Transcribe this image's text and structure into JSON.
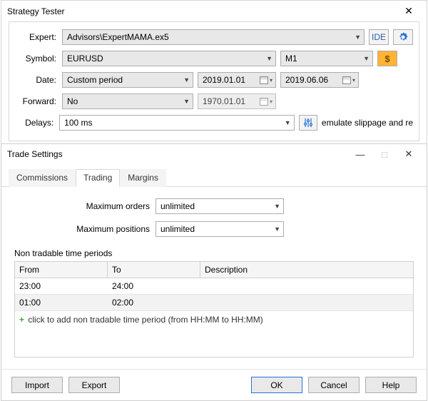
{
  "st": {
    "title": "Strategy Tester",
    "expert_lbl": "Expert:",
    "expert_val": "Advisors\\ExpertMAMA.ex5",
    "ide_label": "IDE",
    "symbol_lbl": "Symbol:",
    "symbol_val": "EURUSD",
    "tf_val": "M1",
    "date_lbl": "Date:",
    "period_val": "Custom period",
    "date_from": "2019.01.01",
    "date_to": "2019.06.06",
    "forward_lbl": "Forward:",
    "forward_val": "No",
    "forward_date": "1970.01.01",
    "delays_lbl": "Delays:",
    "delays_val": "100 ms",
    "delays_hint": "emulate slippage and re"
  },
  "ts": {
    "title": "Trade Settings",
    "tabs": {
      "commissions": "Commissions",
      "trading": "Trading",
      "margins": "Margins"
    },
    "max_orders_lbl": "Maximum orders",
    "max_orders_val": "unlimited",
    "max_pos_lbl": "Maximum positions",
    "max_pos_val": "unlimited",
    "section": "Non tradable time periods",
    "col_from": "From",
    "col_to": "To",
    "col_desc": "Description",
    "rows": [
      {
        "from": "23:00",
        "to": "24:00",
        "desc": ""
      },
      {
        "from": "01:00",
        "to": "02:00",
        "desc": ""
      }
    ],
    "add_hint": "click to add non tradable time period (from HH:MM to HH:MM)",
    "buttons": {
      "import": "Import",
      "export": "Export",
      "ok": "OK",
      "cancel": "Cancel",
      "help": "Help"
    }
  }
}
